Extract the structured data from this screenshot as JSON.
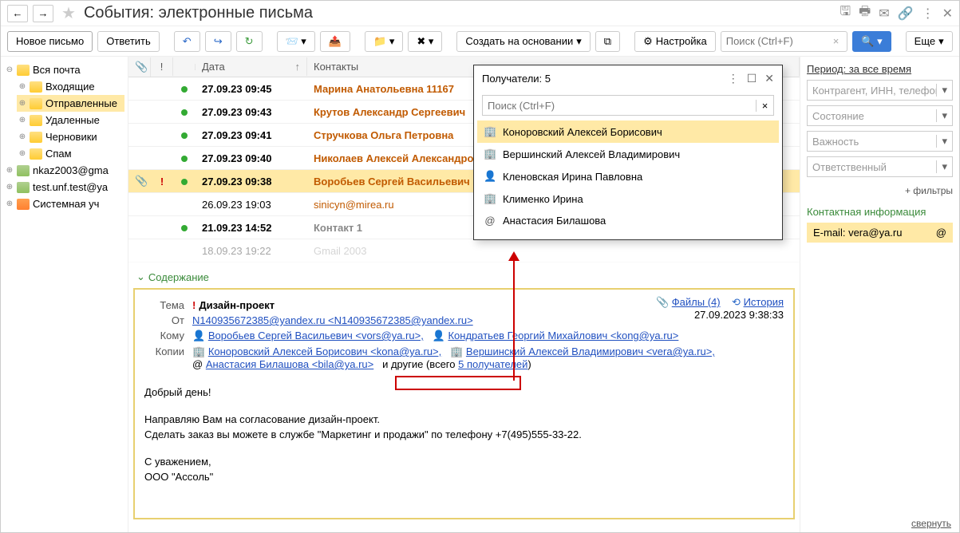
{
  "header": {
    "title": "События: электронные письма"
  },
  "toolbar": {
    "new_letter": "Новое письмо",
    "reply": "Ответить",
    "create_based": "Создать на основании",
    "settings": "Настройка",
    "search_placeholder": "Поиск (Ctrl+F)",
    "more": "Еще"
  },
  "sidebar": {
    "root": "Вся почта",
    "items": [
      {
        "label": "Входящие"
      },
      {
        "label": "Отправленные"
      },
      {
        "label": "Удаленные"
      },
      {
        "label": "Черновики"
      },
      {
        "label": "Спам"
      }
    ],
    "accounts": [
      {
        "label": "nkaz2003@gma"
      },
      {
        "label": "test.unf.test@ya"
      },
      {
        "label": "Системная уч"
      }
    ]
  },
  "grid": {
    "col_date": "Дата",
    "col_contacts": "Контакты",
    "rows": [
      {
        "dot": true,
        "date": "27.09.23 09:45",
        "contacts": "Марина Анатольевна 11167",
        "bold": true
      },
      {
        "dot": true,
        "date": "27.09.23 09:43",
        "contacts": "Крутов Александр Сергеевич",
        "bold": true
      },
      {
        "dot": true,
        "date": "27.09.23 09:41",
        "contacts": "Стручкова Ольга Петровна",
        "bold": true
      },
      {
        "dot": true,
        "date": "27.09.23 09:40",
        "contacts": "Николаев Алексей Александрович",
        "bold": true
      },
      {
        "attach": true,
        "imp": true,
        "dot": true,
        "date": "27.09.23 09:38",
        "contacts": "Воробьев Сергей Васильевич",
        "bold": true,
        "selected": true
      },
      {
        "date": "26.09.23 19:03",
        "contacts": "sinicyn@mirea.ru <sinicyn@mirea.ru>",
        "orange_contact": true
      },
      {
        "dot": true,
        "date": "21.09.23 14:52",
        "contacts": "Контакт 1 <n140935672385@yandex.ru>",
        "gray_contact": true,
        "bold": true
      },
      {
        "date": "18.09.23 19:22",
        "contacts": "Gmail 2003 <nkaz2003@gmail.com>",
        "gray_contact": true,
        "faded": true
      }
    ]
  },
  "content_toggle": "Содержание",
  "mail": {
    "labels": {
      "subject": "Тема",
      "from": "От",
      "to": "Кому",
      "cc": "Копии"
    },
    "subject": "Дизайн-проект",
    "from": "N140935672385@yandex.ru <N140935672385@yandex.ru>",
    "to1": "Воробьев Сергей Васильевич <vors@ya.ru>,",
    "to2": "Кондратьев Георгий Михайлович <kong@ya.ru>",
    "cc1": "Коноровский Алексей Борисович <kona@ya.ru>,",
    "cc2": "Вершинский Алексей Владимирович <vera@ya.ru>,",
    "cc3": "Анастасия Билашова <bila@ya.ru>",
    "others_prefix": "и другие (всего ",
    "others_link": "5 получателей",
    "others_suffix": ")",
    "files": "Файлы (4)",
    "history": "История",
    "timestamp": "27.09.2023 9:38:33",
    "body": {
      "greeting": "Добрый день!",
      "line1": "Направляю Вам на согласование дизайн-проект.",
      "line2": "Сделать заказ вы можете в службе \"Маркетинг и продажи\" по телефону +7(495)555-33-22.",
      "sign1": "С уважением,",
      "sign2": "ООО \"Ассоль\""
    }
  },
  "rightbar": {
    "period": "Период: за все время",
    "f1": "Контрагент, ИНН, телефон",
    "f2": "Состояние",
    "f3": "Важность",
    "f4": "Ответственный",
    "more_filters": "+ фильтры",
    "contact_header": "Контактная информация",
    "contact_label": "E-mail:",
    "contact_value": "vera@ya.ru"
  },
  "popup": {
    "title": "Получатели: 5",
    "search_placeholder": "Поиск (Ctrl+F)",
    "items": [
      {
        "icon": "org",
        "text": "Коноровский Алексей Борисович <kona@ya.ru>",
        "selected": true
      },
      {
        "icon": "org",
        "text": "Вершинский Алексей Владимирович <vera@ya.ru>"
      },
      {
        "icon": "person",
        "text": "Кленовская Ирина Павловна <klei@ya.ru>"
      },
      {
        "icon": "org",
        "text": "Клименко Ирина <klii@ya.ru>"
      },
      {
        "icon": "at",
        "text": "Анастасия Билашова <bila@ya.ru>"
      }
    ]
  },
  "collapse": "свернуть"
}
